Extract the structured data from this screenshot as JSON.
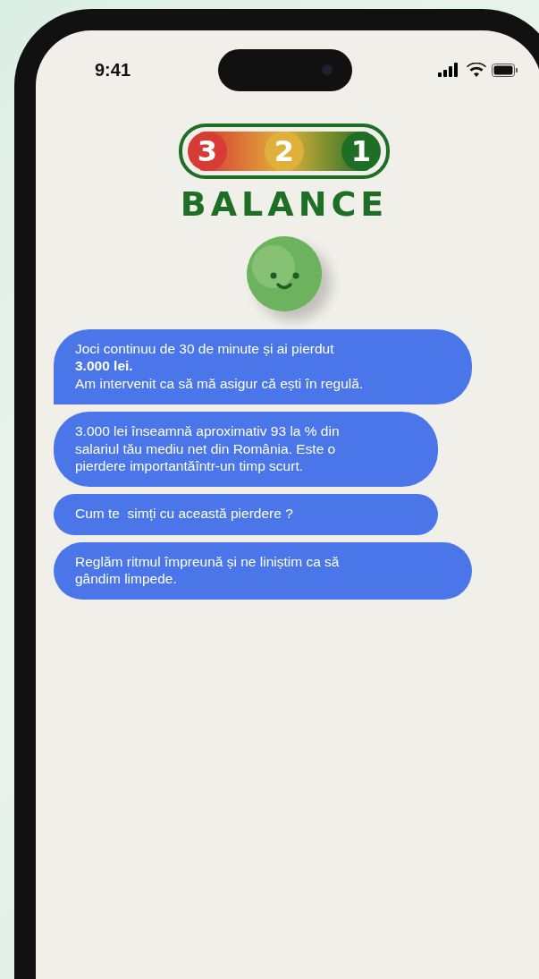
{
  "status_bar": {
    "time": "9:41"
  },
  "logo": {
    "digits": [
      {
        "text": "3",
        "color": "#d83a35"
      },
      {
        "text": "2",
        "color": "#e0b13a"
      },
      {
        "text": "1",
        "color": "#1f6e26"
      }
    ],
    "wordmark": "BALANCE"
  },
  "messages": [
    {
      "text": "Joci continuu de 30 de minute și ai pierdut\n**3.000 lei.**\nAm intervenit ca să mă asigur că ești în regulă."
    },
    {
      "text": "3.000 lei înseamnă aproximativ 93 la % din\nsalariul tău mediu net din România. Este o\npierdere importantăîntr-un timp scurt."
    },
    {
      "text": "Cum te  simți cu această pierdere ?"
    },
    {
      "text": "Reglăm ritmul împreună și ne liniștim ca să\ngândim limpede."
    }
  ]
}
